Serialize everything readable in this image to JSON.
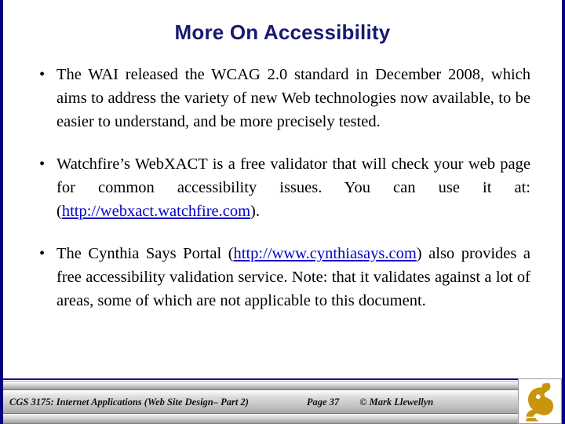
{
  "slide": {
    "title": "More On Accessibility",
    "title_color": "#191970",
    "border_color": "#000080",
    "link_color": "#0000cd",
    "bullets": [
      {
        "marker": "•",
        "segments": [
          {
            "type": "text",
            "value": "The WAI released the WCAG 2.0 standard in December 2008, which aims to address the variety of new Web technologies now available, to be easier to understand, and be more precisely tested."
          }
        ]
      },
      {
        "marker": "•",
        "segments": [
          {
            "type": "text",
            "value": "Watchfire’s WebXACT is a free validator that will check your web page for common accessibility issues. You can use it at: ("
          },
          {
            "type": "link",
            "value": "http://webxact.watchfire.com"
          },
          {
            "type": "text",
            "value": ")."
          }
        ]
      },
      {
        "marker": "•",
        "segments": [
          {
            "type": "text",
            "value": "The Cynthia Says Portal ("
          },
          {
            "type": "link",
            "value": "http://www.cynthiasays.com"
          },
          {
            "type": "text",
            "value": ") also provides a free accessibility validation service.  Note: that it validates against a lot of areas, some of which are not applicable to this document."
          }
        ]
      }
    ]
  },
  "footer": {
    "course": "CGS 3175: Internet Applications (Web Site Design– Part 2)",
    "page": "Page 37",
    "copyright": "© Mark Llewellyn",
    "logo_name": "ucf-pegasus-logo",
    "logo_color": "#c8960c"
  }
}
